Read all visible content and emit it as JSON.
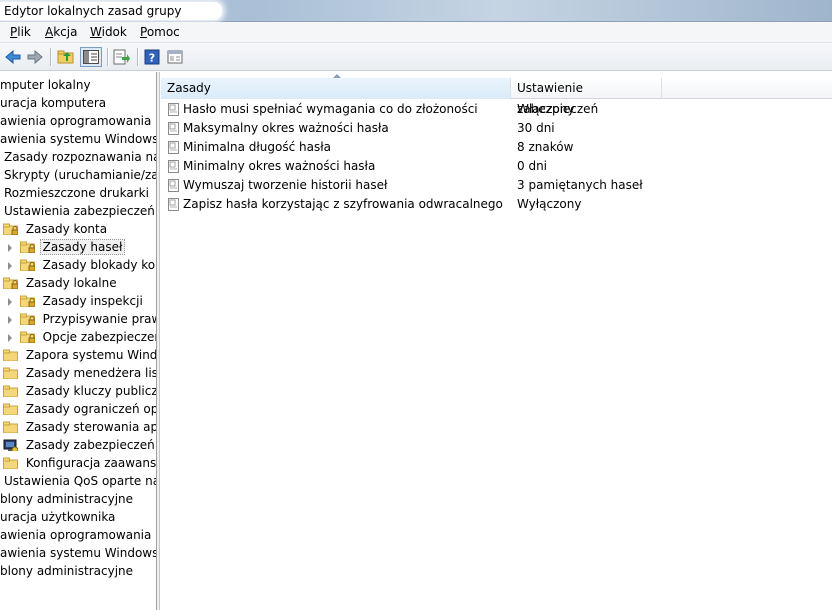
{
  "window": {
    "title": "Edytor lokalnych zasad grupy"
  },
  "menu": [
    "Plik",
    "Akcja",
    "Widok",
    "Pomoc"
  ],
  "toolbar": {
    "buttons": [
      "back-arrow-icon",
      "forward-arrow-icon",
      "up-folder-icon",
      "show-hide-tree-icon",
      "export-list-icon",
      "help-icon",
      "properties-icon"
    ]
  },
  "tree": {
    "items": [
      {
        "label": "mputer lokalny"
      },
      {
        "label": "uracja komputera"
      },
      {
        "label": "awienia oprogramowania"
      },
      {
        "label": "awienia systemu Windows"
      },
      {
        "label": "Zasady rozpoznawania nazw"
      },
      {
        "label": "Skrypty (uruchamianie/zamy"
      },
      {
        "label": "Rozmieszczone drukarki"
      },
      {
        "label": "Ustawienia zabezpieczeń"
      },
      {
        "label": "Zasady konta"
      },
      {
        "label": "Zasady haseł"
      },
      {
        "label": "Zasady blokady konta"
      },
      {
        "label": "Zasady lokalne"
      },
      {
        "label": "Zasady inspekcji"
      },
      {
        "label": "Przypisywanie praw u"
      },
      {
        "label": "Opcje zabezpieczeń"
      },
      {
        "label": "Zapora systemu Window"
      },
      {
        "label": "Zasady menedżera listy s"
      },
      {
        "label": "Zasady kluczy publiczny"
      },
      {
        "label": "Zasady ograniczeń oprog"
      },
      {
        "label": "Zasady sterowania aplika"
      },
      {
        "label": "Zasady zabezpieczeń IP w"
      },
      {
        "label": "Konfiguracja zaawansow"
      },
      {
        "label": "Ustawienia QoS oparte na za"
      },
      {
        "label": "blony administracyjne"
      },
      {
        "label": "uracja użytkownika"
      },
      {
        "label": "awienia oprogramowania"
      },
      {
        "label": "awienia systemu Windows"
      },
      {
        "label": "blony administracyjne"
      }
    ],
    "selected_label": "Zasady haseł"
  },
  "list": {
    "columns": [
      "Zasady",
      "Ustawienie zabezpieczeń"
    ],
    "rows": [
      {
        "name": "Hasło musi spełniać wymagania co do złożoności",
        "value": "Włączony"
      },
      {
        "name": "Maksymalny okres ważności hasła",
        "value": "30 dni"
      },
      {
        "name": "Minimalna długość hasła",
        "value": "8 znaków"
      },
      {
        "name": "Minimalny okres ważności hasła",
        "value": "0 dni"
      },
      {
        "name": "Wymuszaj tworzenie historii haseł",
        "value": "3 pamiętanych haseł"
      },
      {
        "name": "Zapisz hasła korzystając z szyfrowania odwracalnego",
        "value": "Wyłączony"
      }
    ]
  },
  "colors": {
    "folder": "#f3d77a",
    "selection": "#f0f0f0",
    "sorted_header": "#dcecf9"
  }
}
